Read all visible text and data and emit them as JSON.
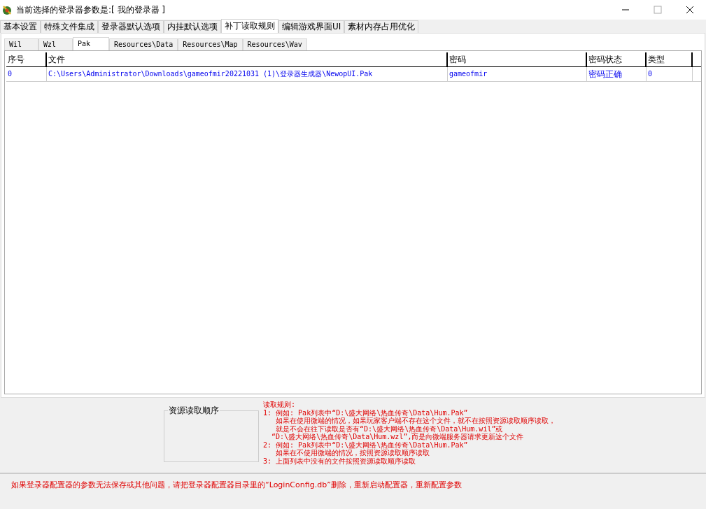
{
  "window": {
    "title": "当前选择的登录器参数是:[ 我的登录器 ]"
  },
  "main_tabs": [
    {
      "label": "基本设置",
      "selected": false
    },
    {
      "label": "特殊文件集成",
      "selected": false
    },
    {
      "label": "登录器默认选项",
      "selected": false
    },
    {
      "label": "内挂默认选项",
      "selected": false
    },
    {
      "label": "补丁读取规则",
      "selected": true
    },
    {
      "label": "编辑游戏界面UI",
      "selected": false
    },
    {
      "label": "素材内存占用优化",
      "selected": false
    }
  ],
  "sub_tabs": [
    {
      "label": "Wil",
      "selected": false
    },
    {
      "label": "Wzl",
      "selected": false
    },
    {
      "label": "Pak",
      "selected": true
    },
    {
      "label": "Resources\\Data",
      "selected": false
    },
    {
      "label": "Resources\\Map",
      "selected": false
    },
    {
      "label": "Resources\\Wav",
      "selected": false
    }
  ],
  "table": {
    "columns": [
      "序号",
      "文件",
      "密码",
      "密码状态",
      "类型"
    ],
    "rows": [
      [
        "0",
        "C:\\Users\\Administrator\\Downloads\\gameofmir20221031 (1)\\登录器生成器\\NewopUI.Pak",
        "gameofmir",
        "密码正确",
        "0"
      ]
    ]
  },
  "resource_order": {
    "label": "资源读取顺序"
  },
  "rules": [
    "读取规则:",
    "1: 例如: Pak列表中“D:\\盛大网络\\热血传奇\\Data\\Hum.Pak”",
    "   如果在使用微端的情况，如果玩家客户端不存在这个文件，就不在按照资源读取顺序读取，",
    "   就是不会在往下读取是否有“D:\\盛大网络\\热血传奇\\Data\\Hum.wil”或",
    "  “D:\\盛大网络\\热血传奇\\Data\\Hum.wzl”,而是向微端服务器请求更新这个文件",
    "2: 例如: Pak列表中“D:\\盛大网络\\热血传奇\\Data\\Hum.Pak”",
    "   如果在不使用微端的情况，按照资源读取顺序读取",
    "3: 上面列表中没有的文件按照资源读取顺序读取"
  ],
  "footer": "如果登录器配置器的参数无法保存或其他问题，请把登录器配置器目录里的“LoginConfig.db”删除，重新启动配置器，重新配置参数"
}
